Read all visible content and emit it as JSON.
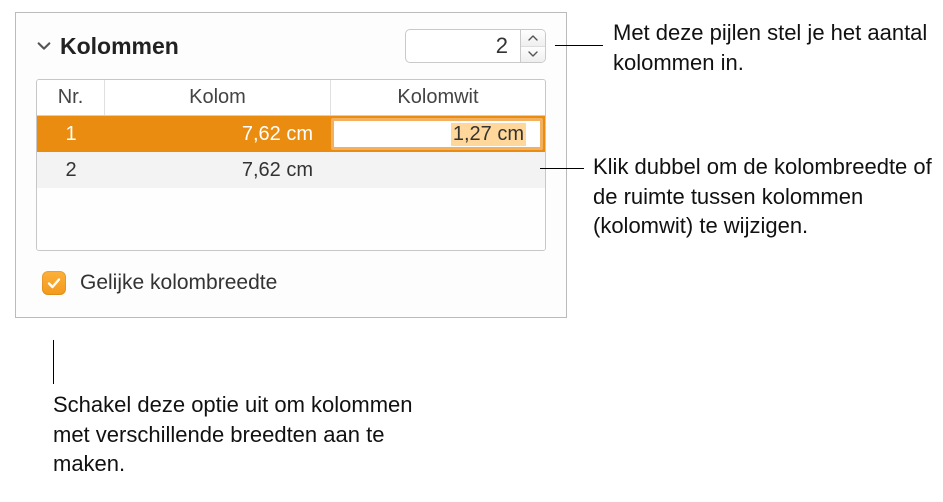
{
  "panel": {
    "section_title": "Kolommen",
    "stepper_value": "2"
  },
  "table": {
    "headers": {
      "nr": "Nr.",
      "kolom": "Kolom",
      "kolomwit": "Kolomwit"
    },
    "rows": [
      {
        "nr": "1",
        "kolom": "7,62 cm",
        "kolomwit": "1,27 cm",
        "selected": true,
        "editing": true
      },
      {
        "nr": "2",
        "kolom": "7,62 cm",
        "kolomwit": "",
        "selected": false,
        "editing": false
      }
    ]
  },
  "checkbox": {
    "label": "Gelijke kolombreedte"
  },
  "callouts": {
    "stepper": "Met deze pijlen stel je het aantal kolommen in.",
    "editcell": "Klik dubbel om de kolombreedte of de ruimte tussen kolommen (kolomwit) te wijzigen.",
    "checkbox": "Schakel deze optie uit om kolommen met verschillende breedten aan te maken."
  }
}
